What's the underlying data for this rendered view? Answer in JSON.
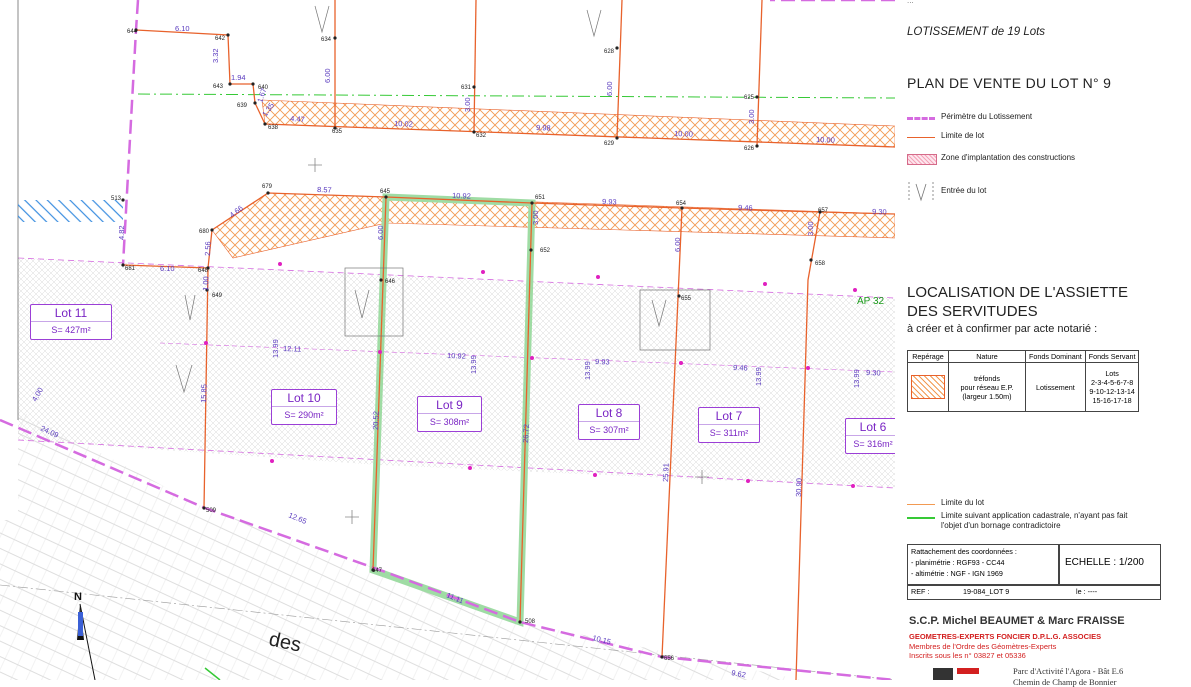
{
  "panel": {
    "header_partial": "...",
    "subdivision_title": "LOTISSEMENT de 19 Lots",
    "plan_title": "PLAN DE VENTE DU LOT N° 9",
    "legend_top": [
      {
        "label": "Périmètre du Lotissement",
        "symbol": "perimeter"
      },
      {
        "label": "Limite de lot",
        "symbol": "lot-limit"
      },
      {
        "label": "Zone d'implantation des constructions",
        "symbol": "building-zone"
      },
      {
        "label": "Entrée du lot",
        "symbol": "lot-entry"
      }
    ],
    "easement_title_line1": "LOCALISATION DE L'ASSIETTE",
    "easement_title_line2": "DES SERVITUDES",
    "easement_subtitle": "à créer et à confirmer par acte notarié :",
    "easement_table": {
      "headers": [
        "Repérage",
        "Nature",
        "Fonds Dominant",
        "Fonds Servant"
      ],
      "row": {
        "nature": [
          "tréfonds",
          "pour réseau E.P.",
          "(largeur 1.50m)"
        ],
        "dominant": "Lotissement",
        "servant": [
          "Lots",
          "2-3-4-5-6-7-8",
          "9-10-12-13-14",
          "15-16-17-18"
        ]
      }
    },
    "legend_bottom": [
      {
        "label": "Limite du lot",
        "symbol": "lot-limit"
      },
      {
        "label": "Limite suivant application cadastrale, n'ayant pas fait",
        "label2": "l'objet d'un bornage contradictoire",
        "symbol": "cadastral"
      }
    ],
    "coordinates": {
      "title": "Rattachement des coordonnées :",
      "planimetry": "- planimétrie : RGF93 - CC44",
      "altimetry": "- altimétrie : NGF - IGN 1969",
      "scale": "ECHELLE : 1/200",
      "ref": "REF :",
      "ref_value": "19-084_LOT 9",
      "date": "le : ----"
    },
    "firm": {
      "name": "S.C.P. Michel BEAUMET & Marc FRAISSE",
      "line1": "GEOMETRES-EXPERTS FONCIER D.P.L.G. ASSOCIES",
      "line2": "Membres de l'Ordre des Géomètres-Experts",
      "line3": "Inscrits sous les n° 03827 et 05336",
      "address1": "Parc d'Activité l'Agora - Bât E.6",
      "address2": "Chemin de Champ de Bonnier"
    },
    "colors": {
      "perimeter": "#d56be0",
      "lot_limit": "#e8622c",
      "hatch": "#f29a52",
      "cadastral": "#36c936",
      "accent_red": "#d32020"
    }
  },
  "plan": {
    "street_text": "des",
    "north": "N",
    "parcel_label": "AP 32",
    "lots": [
      {
        "name": "Lot 11",
        "area": "S= 427m²"
      },
      {
        "name": "Lot 10",
        "area": "S= 290m²"
      },
      {
        "name": "Lot 9",
        "area": "S= 308m²"
      },
      {
        "name": "Lot 8",
        "area": "S= 307m²"
      },
      {
        "name": "Lot 7",
        "area": "S= 311m²"
      },
      {
        "name": "Lot 6",
        "area": "S= 316m²"
      }
    ],
    "points": [
      "644",
      "642",
      "643",
      "640",
      "639",
      "638",
      "634",
      "635",
      "631",
      "632",
      "628",
      "629",
      "625",
      "626",
      "513",
      "679",
      "645",
      "651",
      "654",
      "657",
      "680",
      "681",
      "648",
      "649",
      "646",
      "652",
      "655",
      "658",
      "509",
      "647",
      "508",
      "656"
    ],
    "dimensions": [
      "6.10",
      "3.32",
      "1.94",
      "1.67",
      "1.35",
      "4.47",
      "6.00",
      "10.02",
      "3.00",
      "9.98",
      "6.00",
      "10.00",
      "3.00",
      "10.00",
      "8.57",
      "10.92",
      "9.93",
      "9.46",
      "9.30",
      "4.66",
      "4.82",
      "2.56",
      "6.10",
      "1.00",
      "6.00",
      "3.00",
      "6.00",
      "3.00",
      "12.11",
      "10.92",
      "9.93",
      "9.46",
      "9.30",
      "13.99",
      "13.99",
      "13.99",
      "13.99",
      "13.99",
      "15.85",
      "20.52",
      "26.72",
      "25.91",
      "30.90",
      "4.00",
      "24.09",
      "12.65",
      "11.11",
      "10.15",
      "9.62"
    ]
  }
}
